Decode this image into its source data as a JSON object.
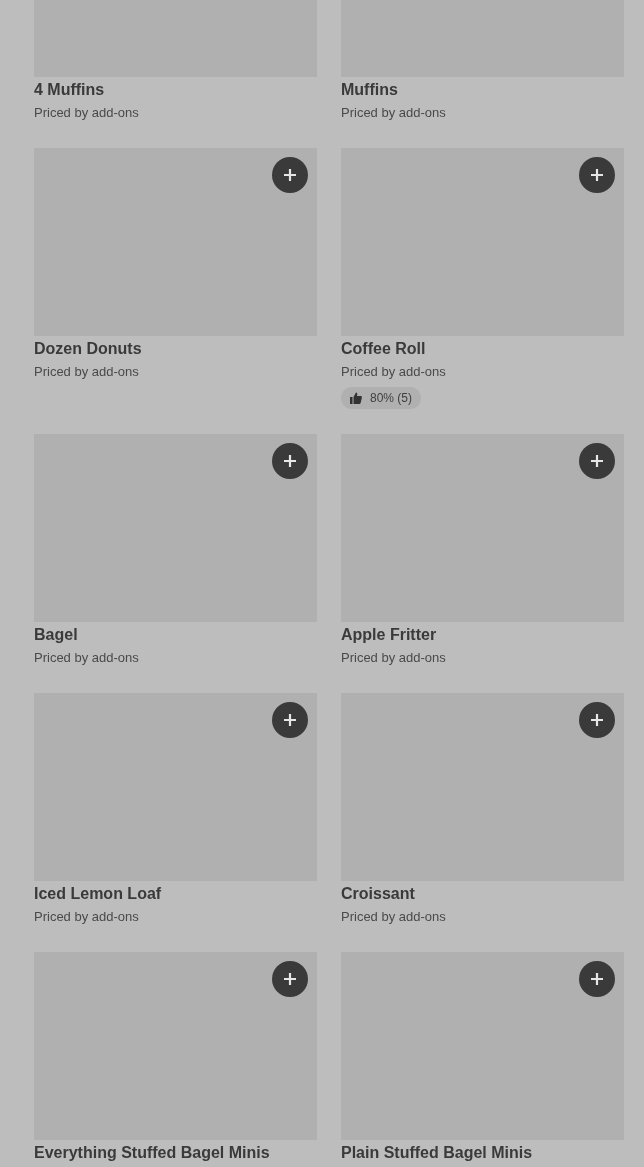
{
  "products": [
    {
      "name": "4 Muffins",
      "price": "Priced by add-ons"
    },
    {
      "name": "Muffins",
      "price": "Priced by add-ons"
    },
    {
      "name": "Dozen Donuts",
      "price": "Priced by add-ons"
    },
    {
      "name": "Coffee Roll",
      "price": "Priced by add-ons",
      "rating": "80% (5)"
    },
    {
      "name": "Bagel",
      "price": "Priced by add-ons"
    },
    {
      "name": "Apple Fritter",
      "price": "Priced by add-ons"
    },
    {
      "name": "Iced Lemon Loaf",
      "price": "Priced by add-ons"
    },
    {
      "name": "Croissant",
      "price": "Priced by add-ons"
    },
    {
      "name": "Everything Stuffed Bagel Minis"
    },
    {
      "name": "Plain Stuffed Bagel Minis"
    }
  ]
}
